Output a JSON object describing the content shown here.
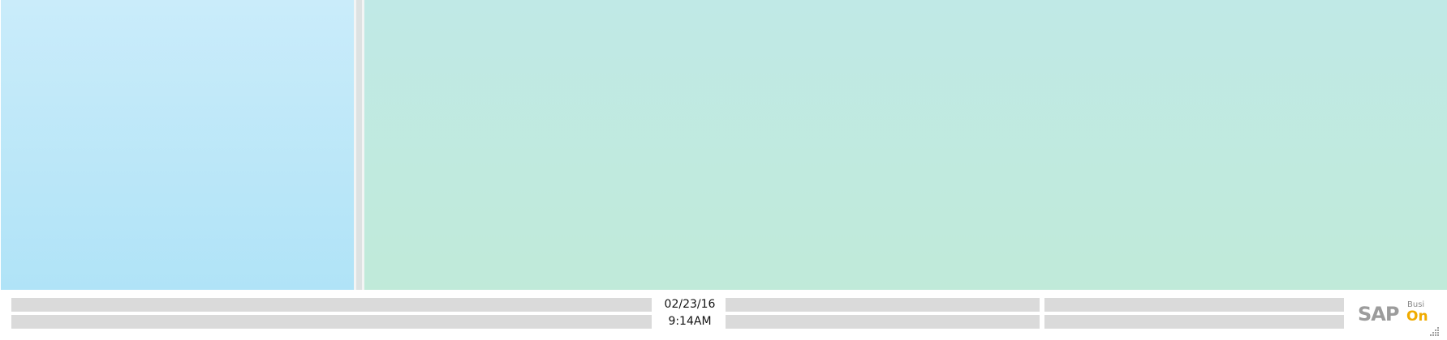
{
  "status_bar": {
    "date": "02/23/16",
    "time": "9:14AM"
  },
  "logo": {
    "brand": "SAP",
    "product_top": "Busi",
    "product_bottom": "On"
  },
  "colors": {
    "left_pane": "#b9e7f8",
    "main_pane": "#c0eae0",
    "field": "#dadada",
    "sap_gray": "#9c9c9c",
    "on_gold": "#f0ab00"
  },
  "icons": {
    "resize_grip": "resize-grip-icon"
  }
}
